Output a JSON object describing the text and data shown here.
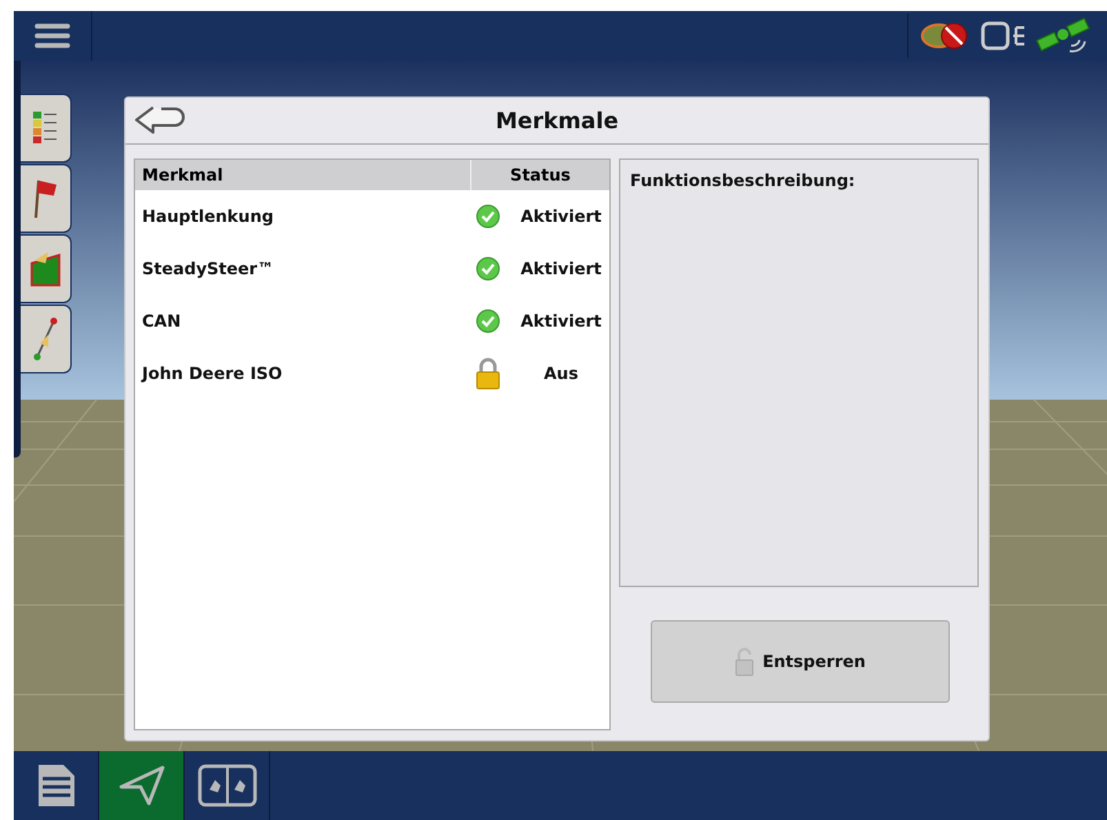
{
  "dialog": {
    "title": "Merkmale",
    "table": {
      "columns": [
        "Merkmal",
        "Status"
      ],
      "rows": [
        {
          "feature": "Hauptlenkung",
          "status": "Aktiviert",
          "kind": "enabled"
        },
        {
          "feature": "SteadySteer™",
          "status": "Aktiviert",
          "kind": "enabled"
        },
        {
          "feature": "CAN",
          "status": "Aktiviert",
          "kind": "enabled"
        },
        {
          "feature": "John Deere ISO",
          "status": "Aus",
          "kind": "locked"
        }
      ]
    },
    "description_label": "Funktionsbeschreibung:",
    "unlock_button": "Entsperren"
  },
  "bottom_tabs": [
    {
      "kind": "document",
      "selected": false
    },
    {
      "kind": "navigate",
      "selected": true
    },
    {
      "kind": "split",
      "selected": false
    }
  ]
}
